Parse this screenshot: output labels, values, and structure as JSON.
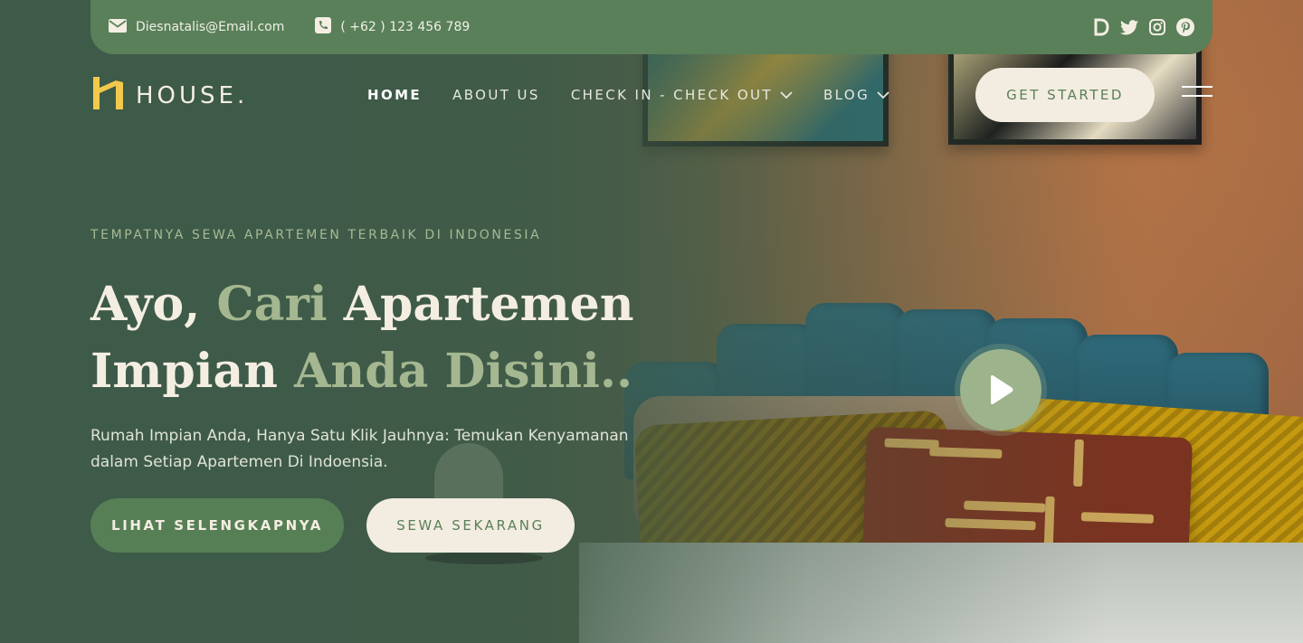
{
  "topbar": {
    "email": "Diesnatalis@Email.com",
    "phone": "( +62 ) 123 456 789",
    "socials": [
      "d-icon",
      "twitter-icon",
      "instagram-icon",
      "pinterest-icon"
    ]
  },
  "brand": {
    "name": "HOUSE."
  },
  "nav": {
    "items": [
      {
        "label": "HOME"
      },
      {
        "label": "ABOUT US"
      },
      {
        "label": "CHECK IN - CHECK OUT"
      },
      {
        "label": "BLOG"
      }
    ],
    "cta": "GET STARTED"
  },
  "hero": {
    "eyebrow": "TEMPATNYA SEWA APARTEMEN TERBAIK DI INDONESIA",
    "headline": {
      "w1": "Ayo,",
      "w2": "Cari",
      "w3": "Apartemen",
      "w4": "Impian",
      "w5": "Anda",
      "w6": "Disini.."
    },
    "description": "Rumah Impian Anda, Hanya Satu Klik Jauhnya: Temukan Kenyamanan dalam Setiap Apartemen Di Indoensia.",
    "primary_button": "LIHAT SELENGKAPNYA",
    "secondary_button": "SEWA SEKARANG"
  },
  "colors": {
    "brand_green": "#5a8059",
    "cream": "#f3ece0",
    "accent_sage": "#a4b790",
    "logo_yellow": "#f2c94c"
  }
}
